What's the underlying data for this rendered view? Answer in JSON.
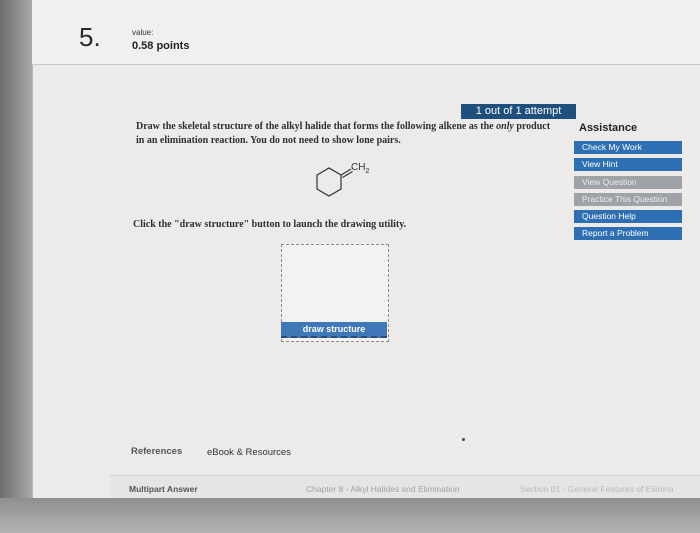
{
  "question": {
    "number": "5.",
    "value_label": "value:",
    "points": "0.58 points"
  },
  "attempt_badge": "1 out of 1 attempt",
  "prompt": {
    "part1": "Draw the skeletal structure of the alkyl halide that forms the following alkene as the ",
    "emphasis": "only",
    "part2": " product in an elimination reaction. You do not need to show lone pairs."
  },
  "molecule_label": "CH",
  "molecule_subscript": "2",
  "instruction": "Click the \"draw structure\" button to launch the drawing utility.",
  "draw_button": "draw structure",
  "assistance": {
    "title": "Assistance",
    "buttons": [
      {
        "label": "Check My Work",
        "state": "active"
      },
      {
        "label": "View Hint",
        "state": "active"
      },
      {
        "label": "View Question",
        "state": "disabled"
      },
      {
        "label": "Practice This Question",
        "state": "disabled"
      },
      {
        "label": "Question Help",
        "state": "active"
      },
      {
        "label": "Report a Problem",
        "state": "active"
      }
    ]
  },
  "links": {
    "references": "References",
    "ebook": "eBook & Resources"
  },
  "footer": {
    "type": "Multipart Answer",
    "chapter": "Chapter 8 - Alkyl Halides and Elimination",
    "section": "Section 01 - General Features of Elimina"
  },
  "colors": {
    "accent_blue": "#2e6fb3",
    "badge_navy": "#1f4f7d",
    "disabled_gray": "#9fa3a8"
  }
}
